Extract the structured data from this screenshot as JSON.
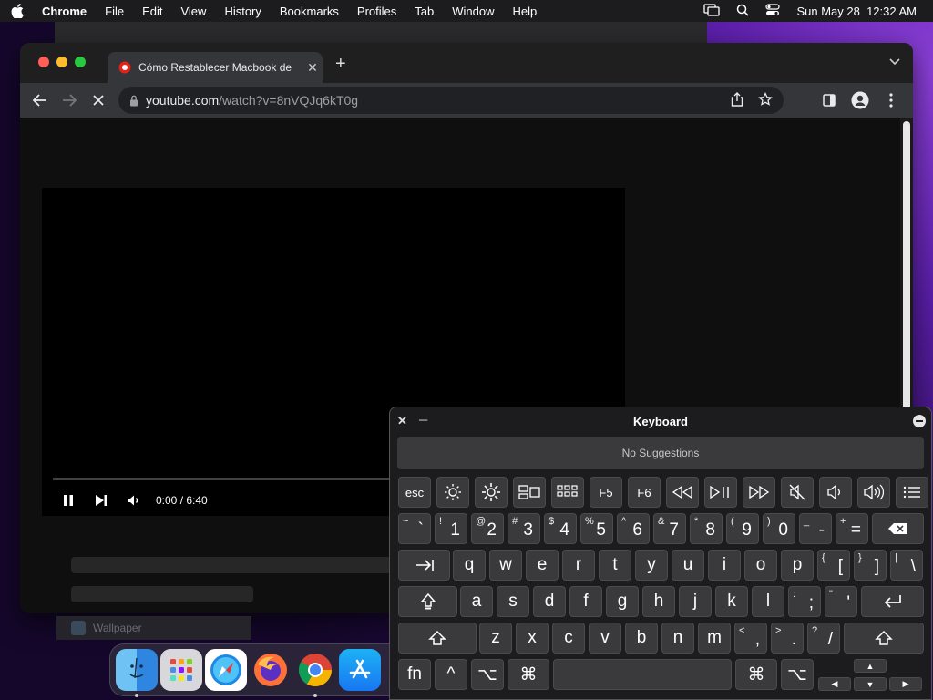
{
  "menubar": {
    "app_name": "Chrome",
    "items": [
      "File",
      "Edit",
      "View",
      "History",
      "Bookmarks",
      "Profiles",
      "Tab",
      "Window",
      "Help"
    ],
    "datetime": "Sun May 28  12:32 AM"
  },
  "browser": {
    "tab_title": "Cómo Restablecer Macbook de",
    "url_host": "youtube.com",
    "url_path": "/watch?v=8nVQJq6kT0g"
  },
  "player": {
    "time": "0:00 / 6:40",
    "progress_fraction": 0
  },
  "bg_window": {
    "label": "Wallpaper"
  },
  "dock": {
    "apps": [
      "Finder",
      "Launchpad",
      "Safari",
      "Firefox",
      "Chrome",
      "App Store"
    ]
  },
  "keyboard": {
    "title": "Keyboard",
    "suggestions": "No Suggestions",
    "fn_row": [
      "esc",
      "brightness-down",
      "brightness-up",
      "mission-control",
      "launchpad",
      "F5",
      "F6",
      "rewind",
      "play-pause",
      "fast-forward",
      "mute",
      "volume-down",
      "volume-up",
      "list"
    ],
    "fn_labels": {
      "esc": "esc",
      "f5": "F5",
      "f6": "F6"
    },
    "num_row": [
      [
        "~",
        "`"
      ],
      [
        "!",
        "1"
      ],
      [
        "@",
        "2"
      ],
      [
        "#",
        "3"
      ],
      [
        "$",
        "4"
      ],
      [
        "%",
        "5"
      ],
      [
        "^",
        "6"
      ],
      [
        "&",
        "7"
      ],
      [
        "*",
        "8"
      ],
      [
        "(",
        "9"
      ],
      [
        ")",
        "0"
      ],
      [
        "_",
        "-"
      ],
      [
        "+",
        "="
      ]
    ],
    "row_q": [
      "q",
      "w",
      "e",
      "r",
      "t",
      "y",
      "u",
      "i",
      "o",
      "p"
    ],
    "row_q_sym": [
      [
        "{",
        "["
      ],
      [
        "}",
        "]"
      ],
      [
        "|",
        "\\"
      ]
    ],
    "row_a": [
      "a",
      "s",
      "d",
      "f",
      "g",
      "h",
      "j",
      "k",
      "l"
    ],
    "row_a_sym": [
      [
        ":",
        ";"
      ],
      [
        "\"",
        "'"
      ]
    ],
    "row_z": [
      "z",
      "x",
      "c",
      "v",
      "b",
      "n",
      "m"
    ],
    "row_z_sym": [
      [
        "<",
        ","
      ],
      [
        ">",
        "."
      ],
      [
        "?",
        "/"
      ]
    ],
    "bottom": {
      "fn": "fn",
      "ctrl": "^",
      "opt": "⌥",
      "cmd": "⌘"
    }
  },
  "colors": {
    "accent": "#ff0000",
    "keyboard_bg": "#1c1c1e",
    "key_bg": "#3a3a3c"
  }
}
